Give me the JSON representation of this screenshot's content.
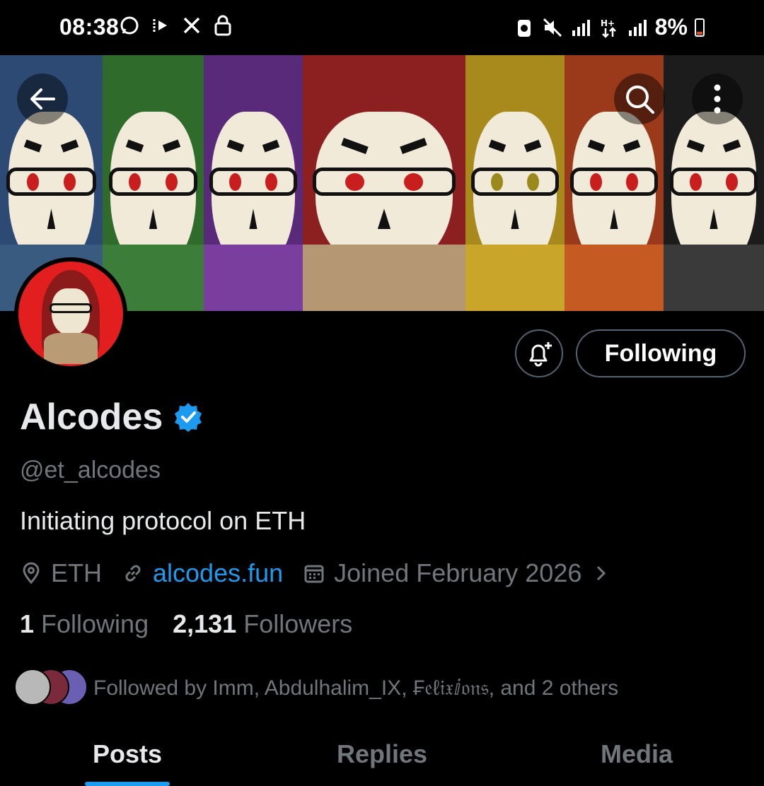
{
  "status_bar": {
    "time": "08:38",
    "battery": "8%",
    "left_icons": [
      "whatsapp-icon",
      "cast-icon",
      "x-icon",
      "lock-icon"
    ],
    "right_icons": [
      "battery-saver-icon",
      "mute-icon",
      "signal-icon",
      "data-icon",
      "signal-icon"
    ]
  },
  "banner": {
    "panels": [
      {
        "hood": "#2c4a73",
        "scarf": "#3a5b80",
        "eye": "#c81e1e"
      },
      {
        "hood": "#2f6b2a",
        "scarf": "#3d7d3a",
        "eye": "#c81e1e"
      },
      {
        "hood": "#5a2a7a",
        "scarf": "#7a3e9e",
        "eye": "#c81e1e"
      },
      {
        "hood": "#8c1f1f",
        "scarf": "#b59873",
        "eye": "#c81e1e"
      },
      {
        "hood": "#a88a1c",
        "scarf": "#c9a52a",
        "eye": "#9a8a1c"
      },
      {
        "hood": "#9a3a1a",
        "scarf": "#c55a22",
        "eye": "#c81e1e"
      },
      {
        "hood": "#1c1c1c",
        "scarf": "#3a3a3a",
        "eye": "#c81e1e"
      }
    ]
  },
  "actions": {
    "following_label": "Following"
  },
  "profile": {
    "name": "Alcodes",
    "handle": "@et_alcodes",
    "bio": "Initiating protocol on ETH",
    "location": "ETH",
    "website": "alcodes.fun",
    "joined": "Joined February 2026"
  },
  "stats": {
    "following_count": "1",
    "following_label": "Following",
    "followers_count": "2,131",
    "followers_label": "Followers"
  },
  "followed_by": {
    "text": "Followed by Imm, Abdulhalim_IX, ₣𝔢ℓ𝔦𝔵ⅈ𝔬𝔫𝔰, and 2 others"
  },
  "tabs": [
    {
      "label": "Posts",
      "active": true
    },
    {
      "label": "Replies",
      "active": false
    },
    {
      "label": "Media",
      "active": false
    }
  ],
  "colors": {
    "accent": "#1d9bf0",
    "muted": "#71767b",
    "text": "#e7e9ea",
    "background": "#000000"
  }
}
